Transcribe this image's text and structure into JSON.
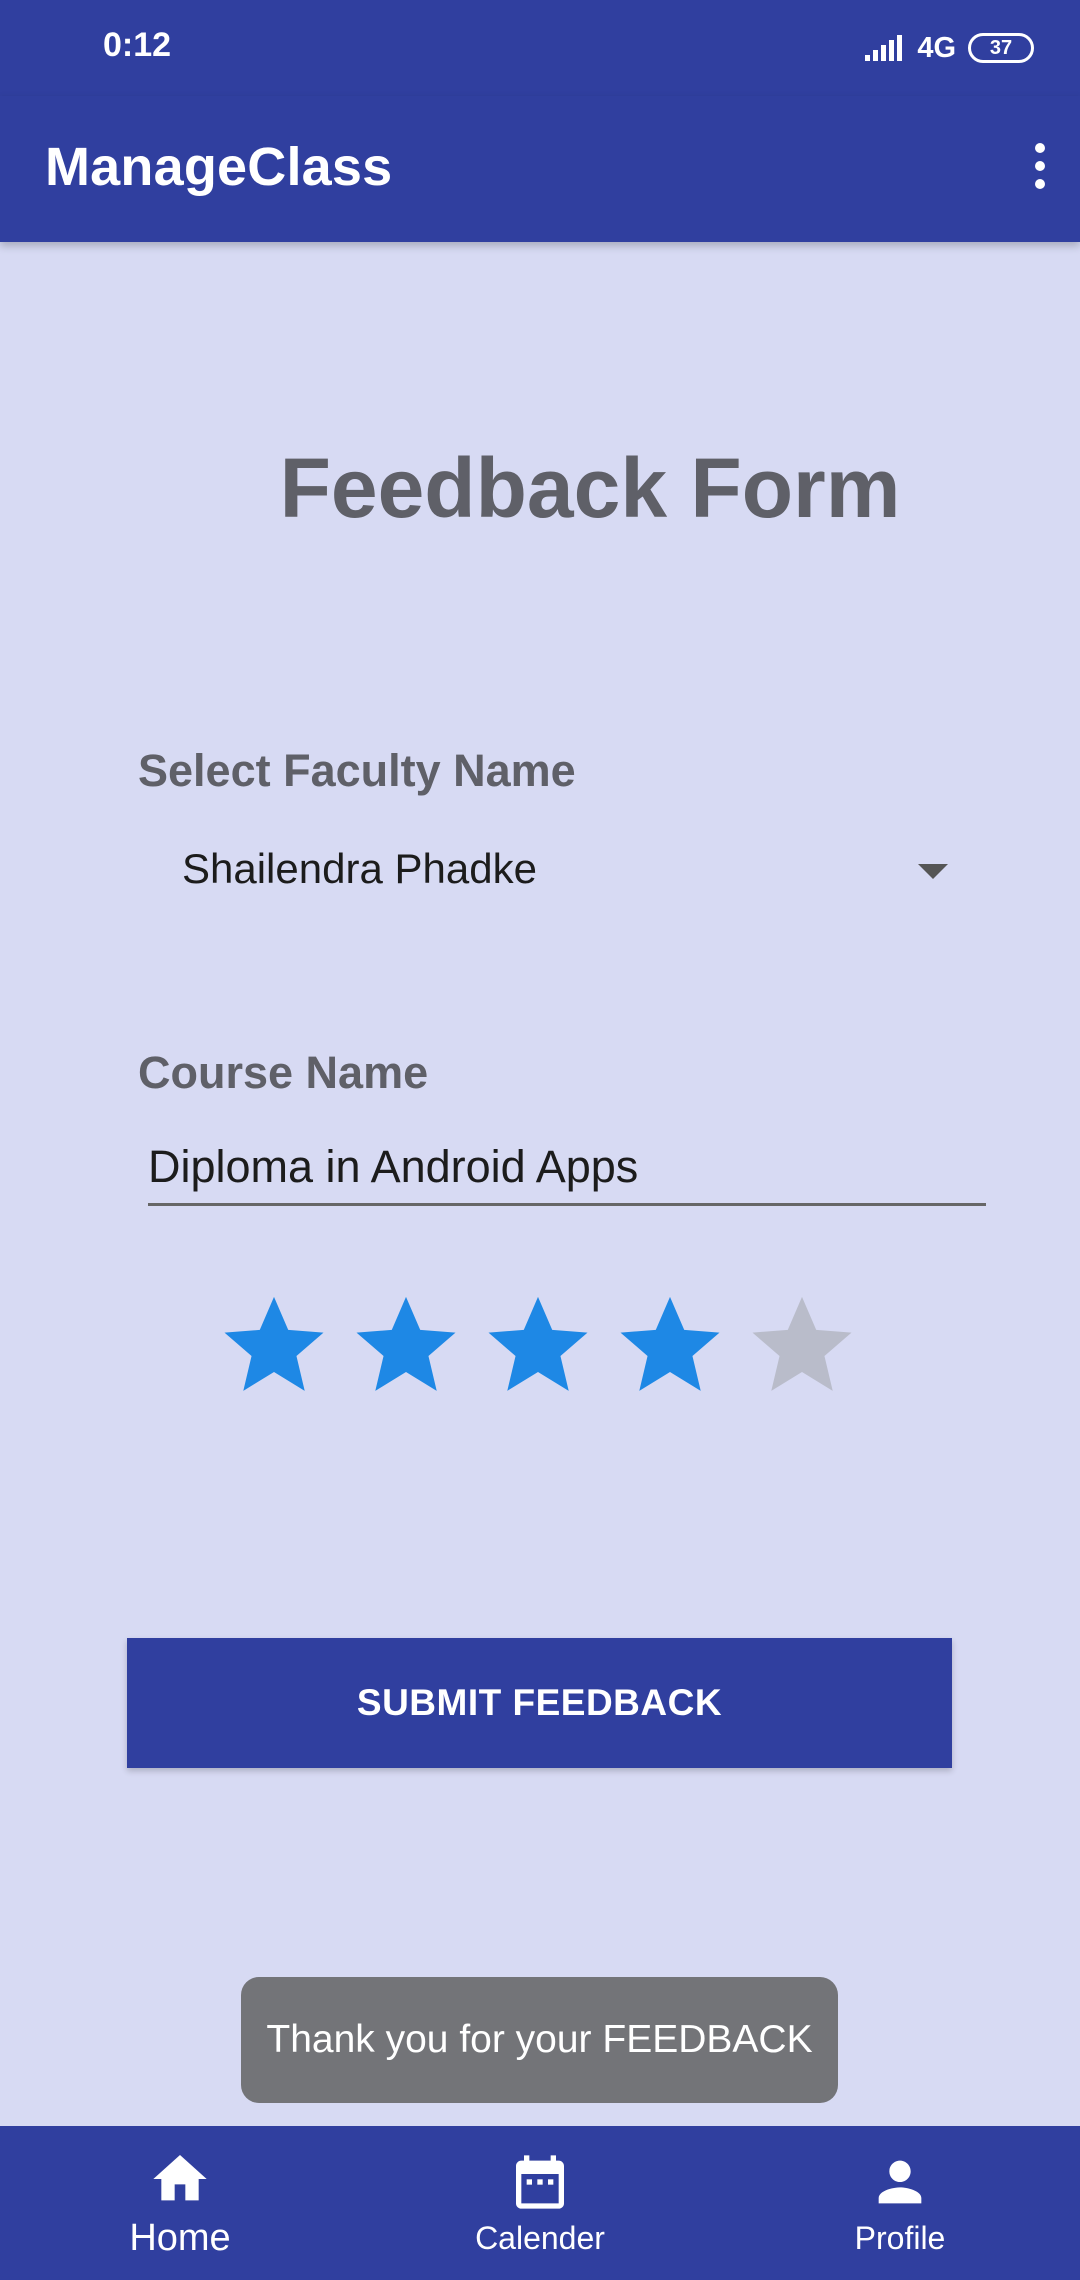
{
  "status_bar": {
    "time": "0:12",
    "network": "4G",
    "battery": "37"
  },
  "app_bar": {
    "title": "ManageClass",
    "overflow_icon": "more-vert-icon"
  },
  "form": {
    "title": "Feedback Form",
    "faculty_label": "Select Faculty Name",
    "faculty_selected": "Shailendra Phadke",
    "course_label": "Course Name",
    "course_value": "Diploma in Android Apps",
    "rating": {
      "value": 4,
      "max": 5
    },
    "submit_label": "SUBMIT FEEDBACK"
  },
  "toast": {
    "message": "Thank you for your FEEDBACK"
  },
  "bottom_nav": {
    "items": [
      {
        "label": "Home",
        "icon": "home-icon",
        "active": true
      },
      {
        "label": "Calender",
        "icon": "calendar-icon",
        "active": false
      },
      {
        "label": "Profile",
        "icon": "person-icon",
        "active": false
      }
    ]
  },
  "colors": {
    "primary": "#303f9f",
    "background": "#d7daf3",
    "star_filled": "#1e88e5",
    "star_empty": "#b9bcca",
    "label_text": "#5f6068",
    "toast_bg": "#737478"
  }
}
